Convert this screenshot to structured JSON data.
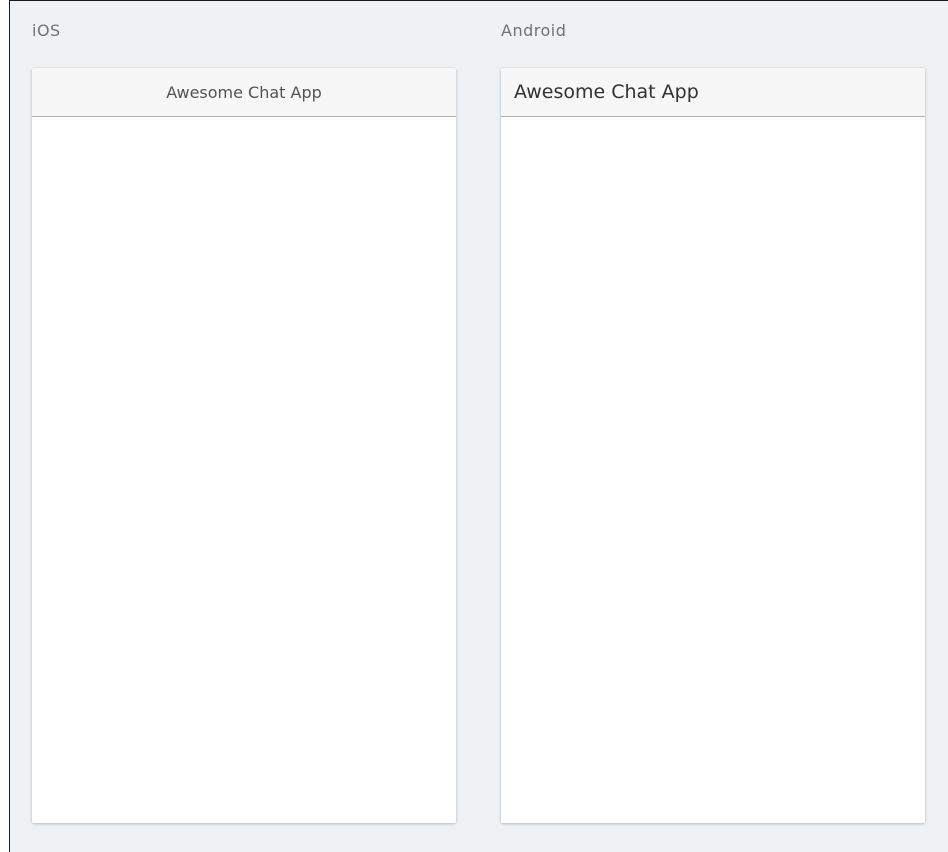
{
  "platforms": {
    "ios": {
      "label": "iOS",
      "nav_title": "Awesome Chat App"
    },
    "android": {
      "label": "Android",
      "nav_title": "Awesome Chat App"
    }
  },
  "colors": {
    "background": "#eff2f5",
    "device_background": "#ffffff",
    "navbar_background": "#f7f7f7",
    "navbar_border": "#b2b2b2",
    "label_text": "#6e7378"
  }
}
